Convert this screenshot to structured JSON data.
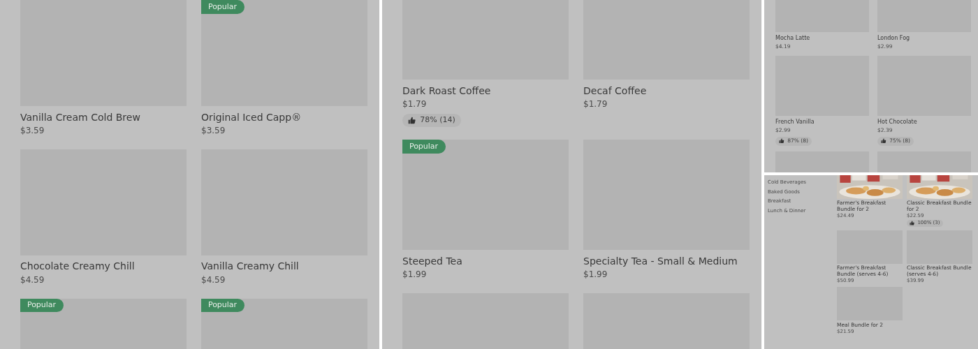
{
  "panels": [
    {
      "items": [
        {
          "kind": "blank",
          "name": "Vanilla Cream Cold Brew",
          "price": "$3.59"
        },
        {
          "kind": "blank",
          "badge": "Popular",
          "name": "Original Iced Capp®",
          "price": "$3.59"
        },
        {
          "kind": "blank",
          "name": "Chocolate Creamy Chill",
          "price": "$4.59"
        },
        {
          "kind": "blank",
          "name": "Vanilla Creamy Chill",
          "price": "$4.59"
        },
        {
          "kind": "blank",
          "badge": "Popular"
        },
        {
          "kind": "blank",
          "badge": "Popular"
        }
      ]
    },
    {
      "items": [
        {
          "kind": "blank",
          "name": "Dark Roast Coffee",
          "price": "$1.79",
          "rating": "78% (14)"
        },
        {
          "kind": "blank",
          "name": "Decaf Coffee",
          "price": "$1.79"
        },
        {
          "kind": "blank",
          "badge": "Popular",
          "name": "Steeped Tea",
          "price": "$1.99"
        },
        {
          "kind": "blank",
          "name": "Specialty Tea - Small & Medium",
          "price": "$1.99"
        },
        {
          "kind": "blank"
        },
        {
          "kind": "blank"
        }
      ]
    },
    {
      "items": [
        {
          "kind": "blank",
          "name": "Mocha Latte",
          "price": "$4.19"
        },
        {
          "kind": "blank",
          "name": "London Fog",
          "price": "$2.99"
        },
        {
          "kind": "blank",
          "name": "French Vanilla",
          "price": "$2.99",
          "rating": "87% (8)"
        },
        {
          "kind": "blank",
          "name": "Hot Chocolate",
          "price": "$2.39",
          "rating": "75% (8)"
        },
        {
          "kind": "blank"
        },
        {
          "kind": "blank"
        }
      ]
    },
    {
      "sidebar": [
        "Cold Beverages",
        "Baked Goods",
        "Breakfast",
        "Lunch & Dinner"
      ],
      "items": [
        {
          "kind": "picture",
          "name": "Farmer's Breakfast Bundle for 2",
          "price": "$24.49"
        },
        {
          "kind": "picture",
          "name": "Classic Breakfast Bundle for 2",
          "price": "$22.59",
          "rating": "100% (3)"
        },
        {
          "kind": "blank",
          "name": "Farmer's Breakfast Bundle (serves 4-6)",
          "price": "$50.99"
        },
        {
          "kind": "blank",
          "name": "Classic Breakfast Bundle (serves 4-6)",
          "price": "$39.99"
        },
        {
          "kind": "blank",
          "name": "Meal Bundle for 2",
          "price": "$21.59"
        }
      ]
    }
  ]
}
